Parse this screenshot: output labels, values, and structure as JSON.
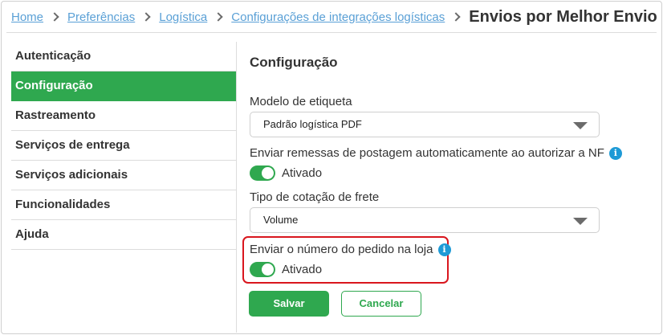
{
  "breadcrumb": {
    "items": [
      "Home",
      "Preferências",
      "Logística",
      "Configurações de integrações logísticas"
    ],
    "current": "Envios por Melhor Envio"
  },
  "sidebar": {
    "items": [
      {
        "label": "Autenticação",
        "active": false
      },
      {
        "label": "Configuração",
        "active": true
      },
      {
        "label": "Rastreamento",
        "active": false
      },
      {
        "label": "Serviços de entrega",
        "active": false
      },
      {
        "label": "Serviços adicionais",
        "active": false
      },
      {
        "label": "Funcionalidades",
        "active": false
      },
      {
        "label": "Ajuda",
        "active": false
      }
    ]
  },
  "main": {
    "title": "Configuração",
    "label_model": "Modelo de etiqueta",
    "model_value": "Padrão logística PDF",
    "auto_send_label": "Enviar remessas de postagem automaticamente ao autorizar a NF",
    "auto_send_state": "Ativado",
    "quote_type_label": "Tipo de cotação de frete",
    "quote_type_value": "Volume",
    "order_number_label": "Enviar o número do pedido na loja",
    "order_number_state": "Ativado",
    "info_glyph": "i"
  },
  "actions": {
    "save": "Salvar",
    "cancel": "Cancelar"
  },
  "colors": {
    "accent": "#2fa84f",
    "link": "#5aa0d6",
    "info": "#1e9ad6",
    "highlight": "#d9161e"
  }
}
